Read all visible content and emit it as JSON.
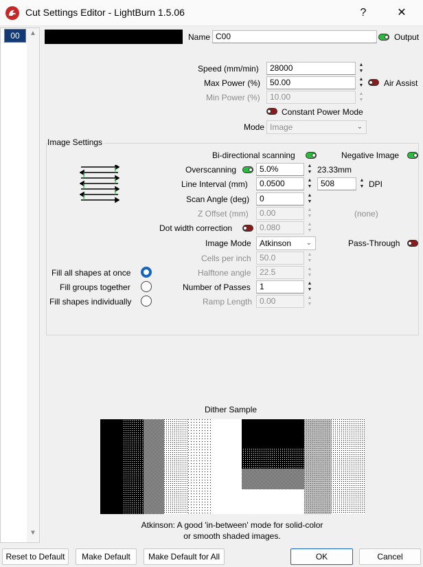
{
  "window": {
    "title": "Cut Settings Editor - LightBurn 1.5.06",
    "help_label": "?",
    "close_label": "✕"
  },
  "layer": {
    "number": "00"
  },
  "name": {
    "label": "Name",
    "value": "C00"
  },
  "output": {
    "label": "Output",
    "on": true
  },
  "speed": {
    "label": "Speed (mm/min)",
    "value": "28000"
  },
  "max_power": {
    "label": "Max Power (%)",
    "value": "50.00"
  },
  "air_assist": {
    "label": "Air Assist",
    "on": false
  },
  "min_power": {
    "label": "Min Power (%)",
    "value": "10.00"
  },
  "constant_power": {
    "label": "Constant Power Mode",
    "on": false
  },
  "mode": {
    "label": "Mode",
    "value": "Image"
  },
  "image_settings": {
    "title": "Image Settings",
    "bidirectional": {
      "label": "Bi-directional scanning",
      "on": true
    },
    "negative": {
      "label": "Negative Image",
      "on": true
    },
    "overscanning": {
      "label": "Overscanning",
      "on": true,
      "value": "5.0%",
      "computed": "23.33mm"
    },
    "line_interval": {
      "label": "Line Interval (mm)",
      "value": "0.0500",
      "dpi_value": "508",
      "dpi_label": "DPI"
    },
    "scan_angle": {
      "label": "Scan Angle (deg)",
      "value": "0"
    },
    "z_offset": {
      "label": "Z Offset (mm)",
      "value": "0.00",
      "extra": "(none)"
    },
    "dot_width": {
      "label": "Dot width correction",
      "on": false,
      "value": "0.080"
    },
    "image_mode": {
      "label": "Image Mode",
      "value": "Atkinson"
    },
    "pass_through": {
      "label": "Pass-Through",
      "on": false
    },
    "cells_per_inch": {
      "label": "Cells per inch",
      "value": "50.0"
    },
    "halftone_angle": {
      "label": "Halftone angle",
      "value": "22.5"
    },
    "passes": {
      "label": "Number of Passes",
      "value": "1"
    },
    "ramp_length": {
      "label": "Ramp Length",
      "value": "0.00"
    },
    "fill_options": [
      {
        "label": "Fill all shapes at once",
        "selected": true
      },
      {
        "label": "Fill groups together",
        "selected": false
      },
      {
        "label": "Fill shapes individually",
        "selected": false
      }
    ]
  },
  "dither": {
    "title": "Dither Sample",
    "caption_line1": "Atkinson: A good 'in-between' mode for solid-color",
    "caption_line2": "or smooth shaded images."
  },
  "buttons": {
    "reset": "Reset to Default",
    "make_default": "Make Default",
    "make_default_all": "Make Default for All",
    "ok": "OK",
    "cancel": "Cancel"
  },
  "colors": {
    "accent": "#1565c0",
    "toggle_on": "#2dbb3d",
    "toggle_off": "#8b1a1a",
    "layer_color": "#000000"
  }
}
